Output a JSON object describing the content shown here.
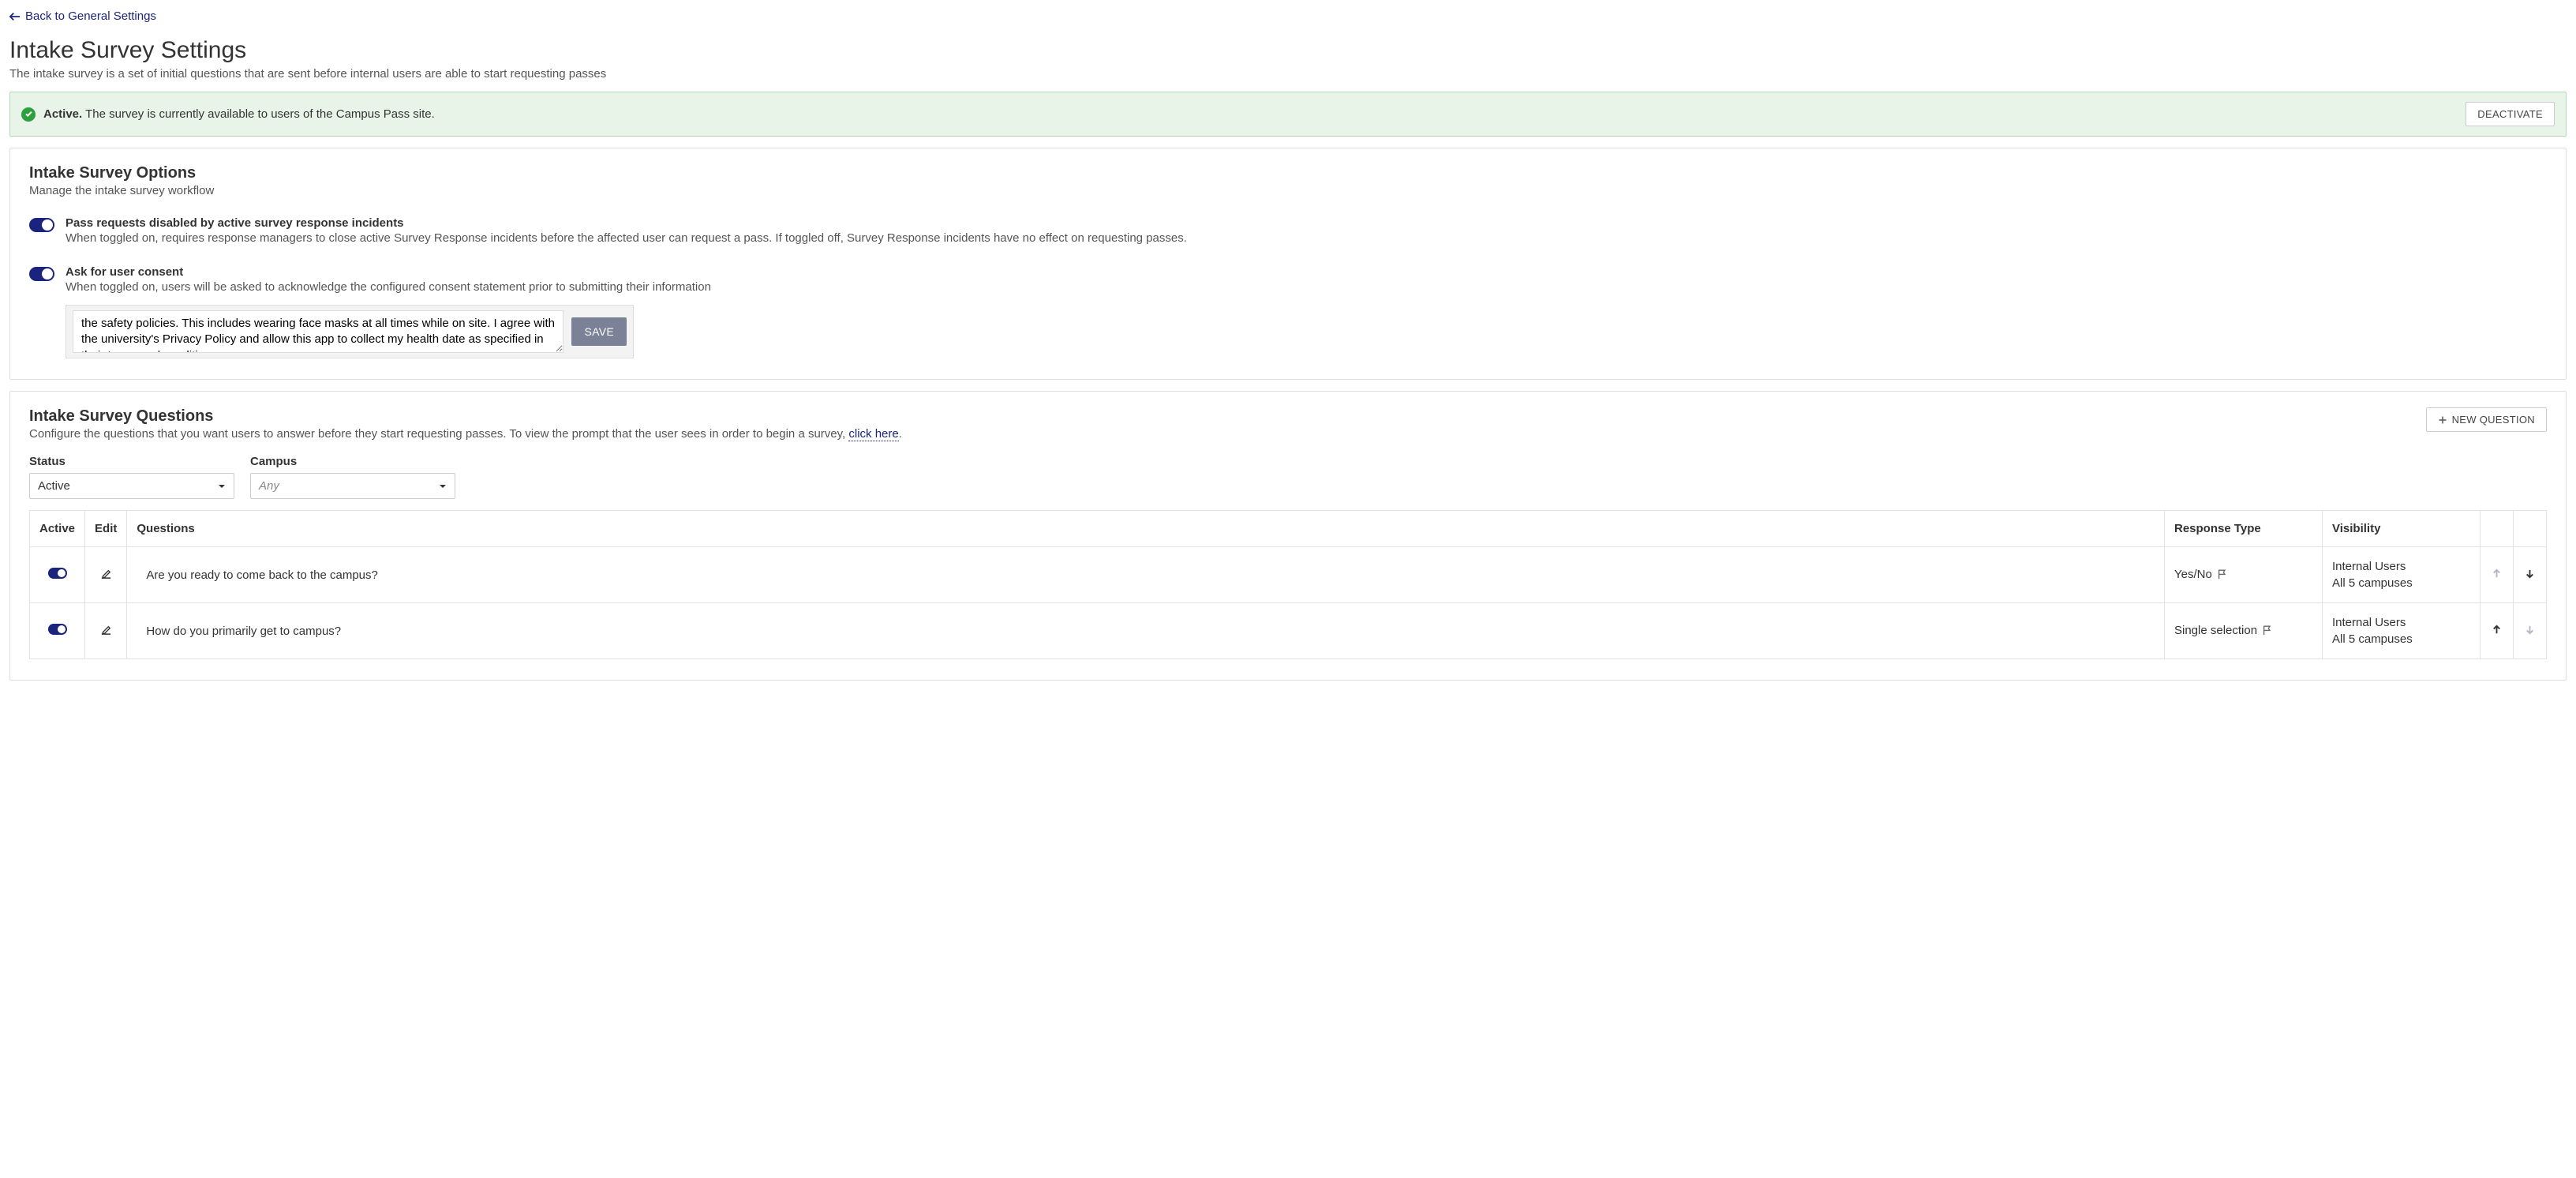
{
  "back_link": "Back to General Settings",
  "page_title": "Intake Survey Settings",
  "page_subtitle": "The intake survey is a set of initial questions that are sent before internal users are able to start requesting passes",
  "status": {
    "label": "Active.",
    "text": "The survey is currently available to users of the Campus Pass site.",
    "deactivate_btn": "DEACTIVATE"
  },
  "options": {
    "title": "Intake Survey Options",
    "subtitle": "Manage the intake survey workflow",
    "pass_requests": {
      "title": "Pass requests disabled by active survey response incidents",
      "desc": "When toggled on, requires response managers to close active Survey Response incidents before the affected user can request a pass. If toggled off, Survey Response incidents have no effect on requesting passes."
    },
    "consent": {
      "title": "Ask for user consent",
      "desc": "When toggled on, users will be asked to acknowledge the configured consent statement prior to submitting their information",
      "text": "the safety policies. This includes wearing face masks at all times while on site. I agree with the university's Privacy Policy and allow this app to collect my health date as specified in their terms and conditions.",
      "save_btn": "SAVE"
    }
  },
  "questions": {
    "title": "Intake Survey Questions",
    "subtitle_pre": "Configure the questions that you want users to answer before they start requesting passes. To view the prompt that the user sees in order to begin a survey, ",
    "click_here": "click here",
    "subtitle_post": ".",
    "new_btn": "NEW QUESTION",
    "filters": {
      "status_label": "Status",
      "status_value": "Active",
      "campus_label": "Campus",
      "campus_value": "Any"
    },
    "headers": {
      "active": "Active",
      "edit": "Edit",
      "question": "Questions",
      "response_type": "Response Type",
      "visibility": "Visibility"
    },
    "rows": [
      {
        "question": "Are you ready to come back to the campus?",
        "response_type": "Yes/No",
        "vis1": "Internal Users",
        "vis2": "All 5 campuses",
        "up_enabled": false,
        "down_enabled": true
      },
      {
        "question": "How do you primarily get to campus?",
        "response_type": "Single selection",
        "vis1": "Internal Users",
        "vis2": "All 5 campuses",
        "up_enabled": true,
        "down_enabled": false
      }
    ]
  }
}
